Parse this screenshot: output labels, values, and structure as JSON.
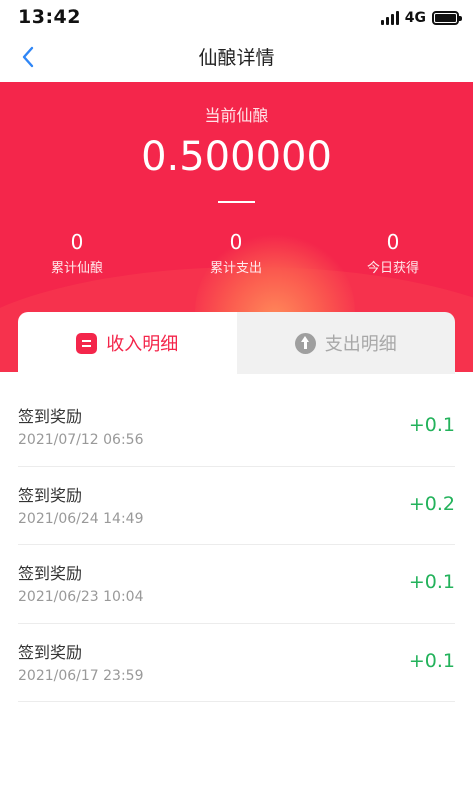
{
  "status_bar": {
    "time": "13:42",
    "network": "4G"
  },
  "nav": {
    "title": "仙酿详情"
  },
  "summary": {
    "label": "当前仙酿",
    "value": "0.500000",
    "stats": [
      {
        "value": "0",
        "label": "累计仙酿"
      },
      {
        "value": "0",
        "label": "累计支出"
      },
      {
        "value": "0",
        "label": "今日获得"
      }
    ]
  },
  "tabs": {
    "income": "收入明细",
    "expense": "支出明细"
  },
  "records": [
    {
      "title": "签到奖励",
      "time": "2021/07/12 06:56",
      "amount": "+0.1"
    },
    {
      "title": "签到奖励",
      "time": "2021/06/24 14:49",
      "amount": "+0.2"
    },
    {
      "title": "签到奖励",
      "time": "2021/06/23 10:04",
      "amount": "+0.1"
    },
    {
      "title": "签到奖励",
      "time": "2021/06/17 23:59",
      "amount": "+0.1"
    }
  ],
  "colors": {
    "accent": "#f4264b",
    "positive": "#23b25b"
  },
  "icons": [
    "back-arrow-icon",
    "signal-icon",
    "battery-icon",
    "income-list-icon",
    "expense-arrow-icon"
  ]
}
